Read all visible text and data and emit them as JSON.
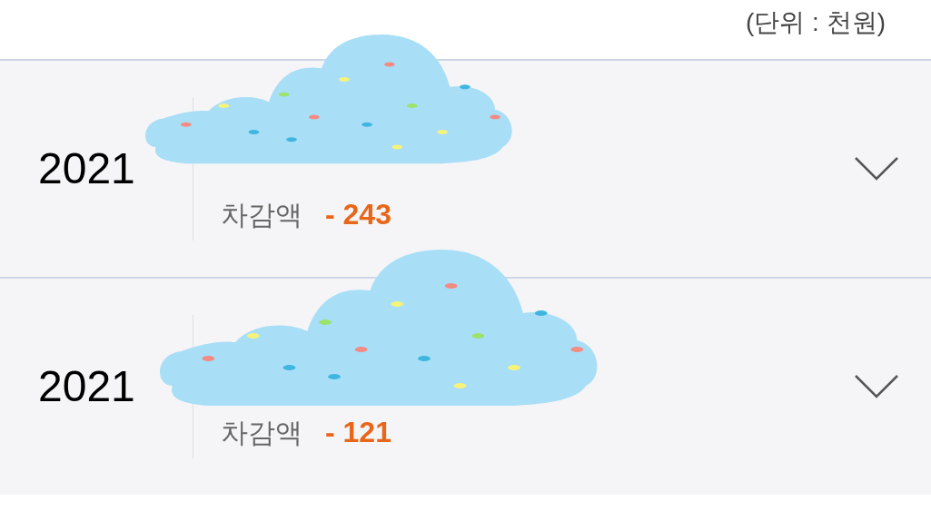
{
  "unit_note": "(단위 : 천원)",
  "items": [
    {
      "year": "2021",
      "deduction_label": "차감액",
      "deduction_value": "- 243",
      "expanded": false
    },
    {
      "year": "2021",
      "deduction_label": "차감액",
      "deduction_value": "- 121",
      "expanded": false
    }
  ]
}
